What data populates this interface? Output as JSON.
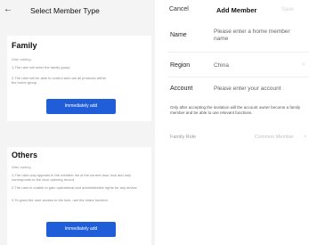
{
  "select_screen": {
    "back_icon": "back-arrow-icon",
    "title": "Select Member Type",
    "family": {
      "title": "Family",
      "after_adding": "After adding",
      "notes": [
        "1.The user will enter the family group",
        "2.The user will be able to control and use all products within the home group"
      ],
      "button": "Immediately add"
    },
    "others": {
      "title": "Others",
      "after_adding": "After adding",
      "notes": [
        "1.The user only appears in the member list of the current door lock and only corresponds to the door opening record",
        "2.The user is unable to gain operational and administrative rights for any device",
        "3.To grant the user access to the lock, use the share function"
      ],
      "button": "Immediately add"
    },
    "colors": {
      "button_blue": "#1f5ed8",
      "background": "#f4f4f4"
    }
  },
  "add_member_screen": {
    "cancel": "Cancel",
    "title": "Add Member",
    "save": "Save",
    "name": {
      "label": "Name",
      "placeholder": "Please enter a home member name"
    },
    "region": {
      "label": "Region",
      "value": "China",
      "chevron": ">"
    },
    "account": {
      "label": "Account",
      "placeholder": "Please enter your account"
    },
    "note": "Only after accepting the invitation will the account owner become a family member and be able to use relevant functions.",
    "family_role": {
      "label": "Family Role",
      "value": "Common Member",
      "chevron": ">"
    }
  }
}
